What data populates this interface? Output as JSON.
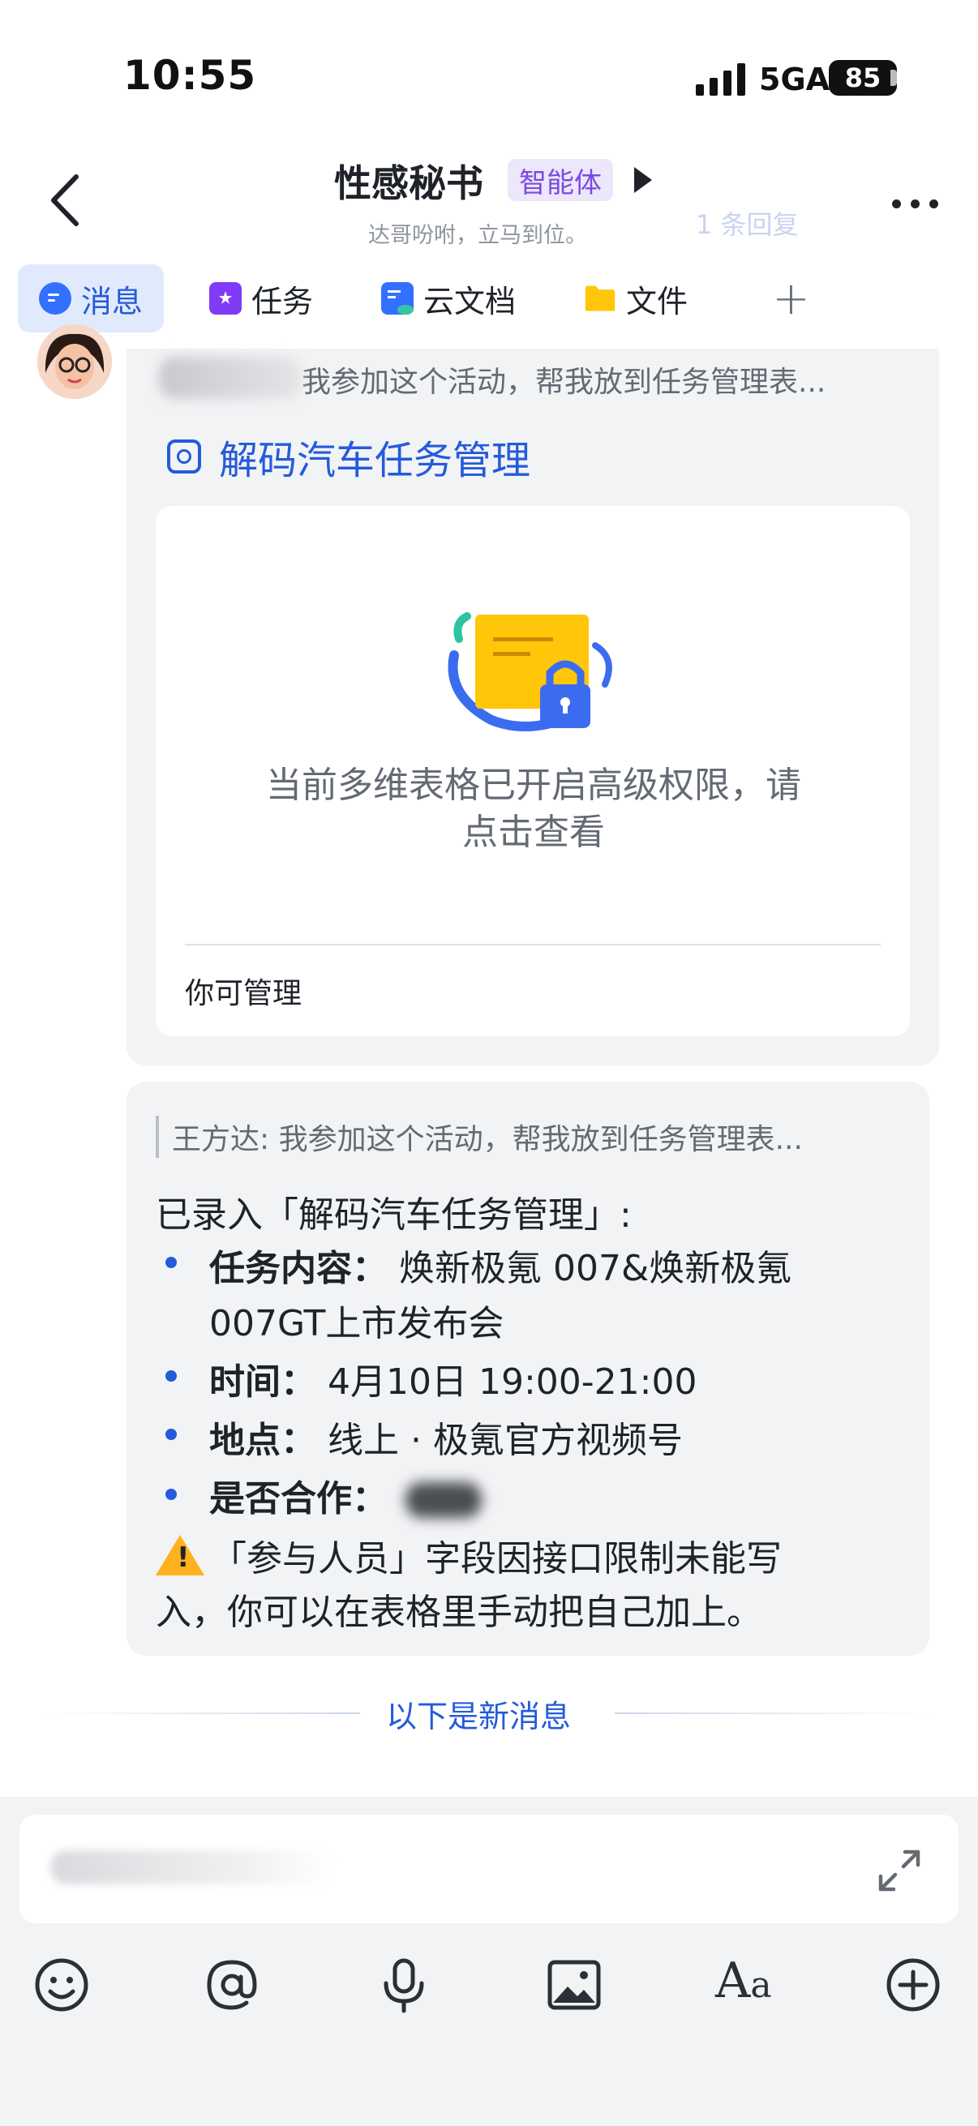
{
  "status_bar": {
    "time": "10:55",
    "network": "5GA",
    "battery": "85"
  },
  "header": {
    "title": "性感秘书",
    "badge": "智能体",
    "subtitle": "达哥吩咐，立马到位。",
    "faded_reply": "1 条回复"
  },
  "tabs": [
    {
      "label": "消息",
      "icon": "message-icon"
    },
    {
      "label": "任务",
      "icon": "task-icon"
    },
    {
      "label": "云文档",
      "icon": "cloud-doc-icon"
    },
    {
      "label": "文件",
      "icon": "folder-icon"
    }
  ],
  "message1": {
    "quote": "我参加这个活动，帮我放到任务管理表...",
    "doc_link": "解码汽车任务管理",
    "permission_text": "当前多维表格已开启高级权限，请点击查看",
    "permission_line1": "当前多维表格已开启高级权限，请",
    "permission_line2": "点击查看",
    "manage_label": "你可管理"
  },
  "message2": {
    "quote": "王方达: 我参加这个活动，帮我放到任务管理表...",
    "intro": "已录入「解码汽车任务管理」:",
    "items": [
      {
        "key": "任务内容：",
        "value": " 焕新极氪 007&焕新极氪",
        "value2": "007GT上市发布会"
      },
      {
        "key": "时间：",
        "value": "  4月10日 19:00-21:00"
      },
      {
        "key": "地点：",
        "value": "  线上 · 极氪官方视频号"
      },
      {
        "key": "是否合作：",
        "value": ""
      }
    ],
    "warning_line1": "「参与人员」字段因接口限制未能写",
    "warning_line2": "入，你可以在表格里手动把自己加上。"
  },
  "separator": "以下是新消息",
  "colors": {
    "accent": "#245bdb",
    "badge_bg": "#ece7fb",
    "badge_text": "#7b4ae0",
    "warning": "#ffb21e"
  }
}
